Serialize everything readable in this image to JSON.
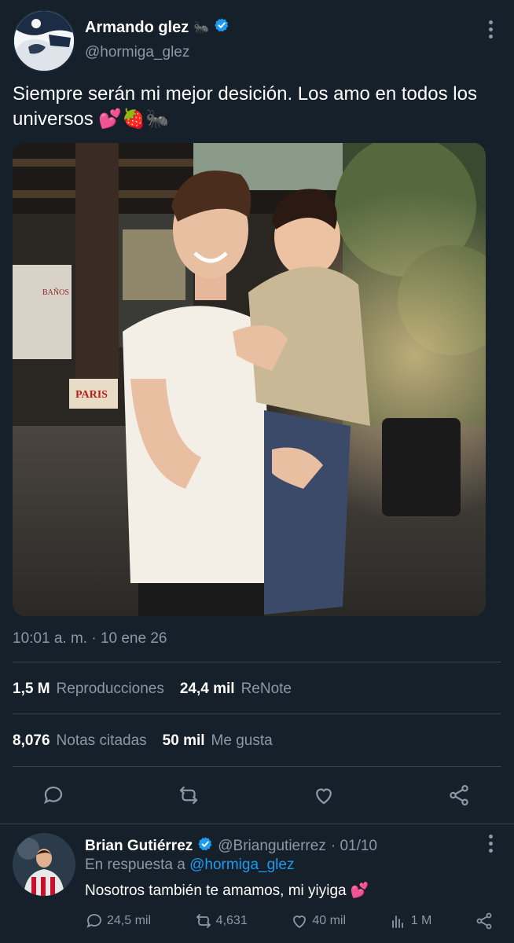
{
  "tweet": {
    "author_name": "Armando glez",
    "author_emoji": "🐜",
    "author_handle": "@hormiga_glez",
    "text": "Siempre serán mi mejor desición. Los amo en todos los universos 💕🍓🐜",
    "timestamp": "10:01 a. m. · 10 ene 26",
    "stats": {
      "views_count": "1,5 M",
      "views_label": "Reproducciones",
      "renote_count": "24,4 mil",
      "renote_label": "ReNote",
      "quotes_count": "8,076",
      "quotes_label": "Notas citadas",
      "likes_count": "50 mil",
      "likes_label": "Me gusta"
    }
  },
  "reply": {
    "author_name": "Brian Gutiérrez",
    "author_handle": "@Briangutierrez",
    "date": "· 01/10",
    "reply_prefix": "En respuesta a",
    "reply_to": "@hormiga_glez",
    "text": "Nosotros también te amamos, mi yiyiga 💕",
    "actions": {
      "replies": "24,5 mil",
      "reposts": "4,631",
      "likes": "40 mil",
      "views": "1 M"
    }
  },
  "colors": {
    "background": "#15202b",
    "muted": "#8b98a5",
    "accent": "#1d9bf0",
    "divider": "#38444d"
  },
  "icons": [
    "verified-badge-icon",
    "more-icon",
    "reply-icon",
    "retweet-icon",
    "like-icon",
    "share-icon",
    "views-icon"
  ]
}
